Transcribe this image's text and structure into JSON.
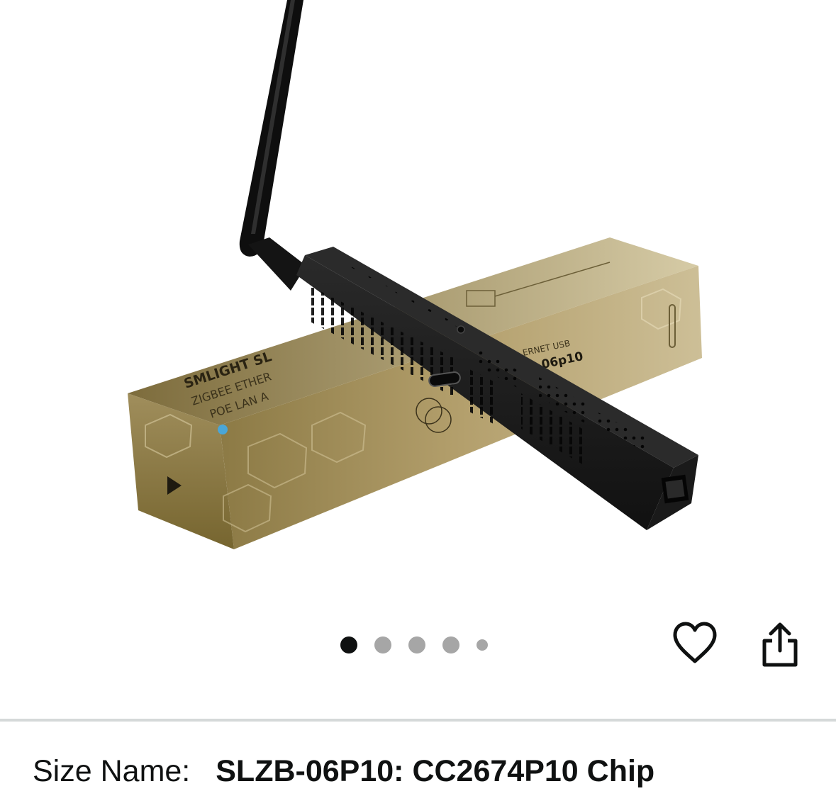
{
  "product_image": {
    "box_brand": "SMLIGHT SL",
    "box_line_1": "ZIGBEE ETHER",
    "box_line_2": "POE LAN A",
    "box_side_line": "ERNET USB",
    "box_model": "06p10"
  },
  "carousel": {
    "dots": [
      {
        "state": "active"
      },
      {
        "state": "inactive"
      },
      {
        "state": "inactive"
      },
      {
        "state": "inactive"
      },
      {
        "state": "small"
      }
    ]
  },
  "actions": {
    "favorite_icon": "heart-outline-icon",
    "share_icon": "share-icon"
  },
  "variation": {
    "label": "Size Name:",
    "value": "SLZB-06P10: CC2674P10 Chip"
  },
  "colors": {
    "text": "#0f1111",
    "dot_active": "#0f1111",
    "dot_inactive": "#a6a6a6",
    "divider": "#d5d9d9",
    "box_gold": "#b0a074",
    "device_black": "#1b1b1b"
  }
}
